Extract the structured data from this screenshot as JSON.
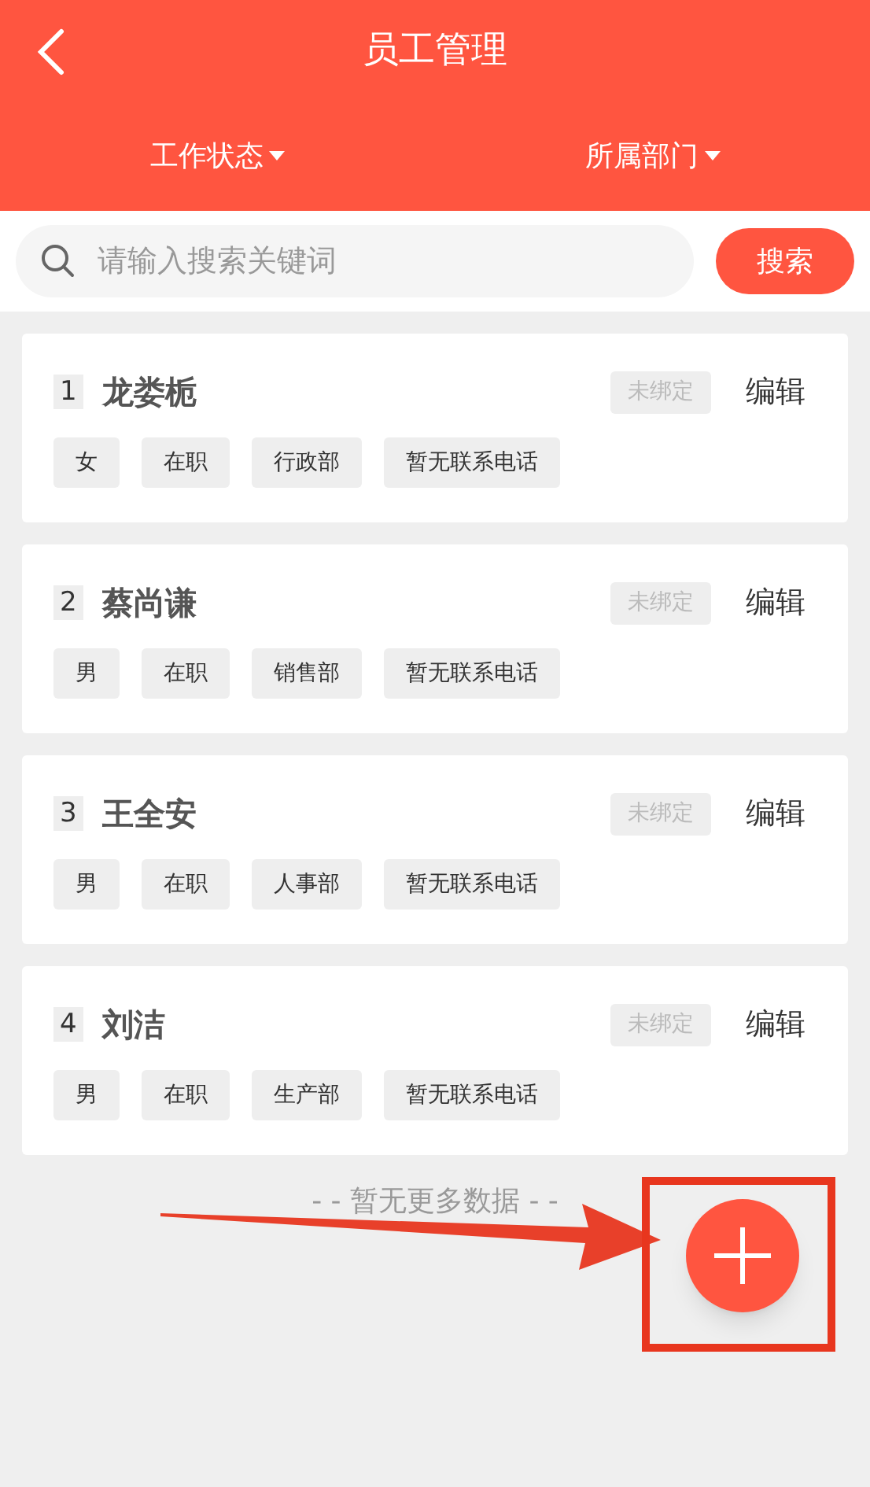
{
  "header": {
    "title": "员工管理"
  },
  "filters": [
    {
      "label": "工作状态"
    },
    {
      "label": "所属部门"
    }
  ],
  "search": {
    "placeholder": "请输入搜索关键词",
    "button": "搜索"
  },
  "employees": [
    {
      "index": "1",
      "name": "龙娄栀",
      "binding": "未绑定",
      "action": "编辑",
      "tags": [
        "女",
        "在职",
        "行政部",
        "暂无联系电话"
      ]
    },
    {
      "index": "2",
      "name": "蔡尚谦",
      "binding": "未绑定",
      "action": "编辑",
      "tags": [
        "男",
        "在职",
        "销售部",
        "暂无联系电话"
      ]
    },
    {
      "index": "3",
      "name": "王全安",
      "binding": "未绑定",
      "action": "编辑",
      "tags": [
        "男",
        "在职",
        "人事部",
        "暂无联系电话"
      ]
    },
    {
      "index": "4",
      "name": "刘洁",
      "binding": "未绑定",
      "action": "编辑",
      "tags": [
        "男",
        "在职",
        "生产部",
        "暂无联系电话"
      ]
    }
  ],
  "footer": "- - 暂无更多数据 - -"
}
